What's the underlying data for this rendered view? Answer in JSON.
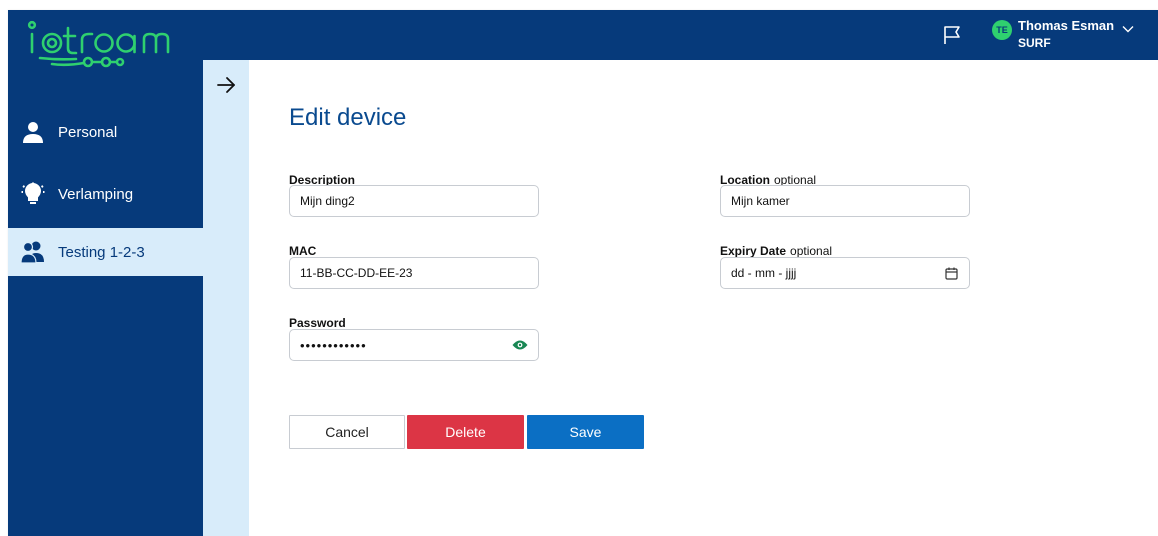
{
  "app": {
    "logo_text": "iotroam",
    "brand_colors": {
      "navy": "#063a7b",
      "green": "#2fd06f",
      "light_blue": "#d8ecfa"
    }
  },
  "header": {
    "flag_icon": "flag-icon",
    "user": {
      "initials": "TE",
      "name": "Thomas Esman",
      "org": "SURF",
      "chevron_icon": "chevron-down-icon"
    }
  },
  "sidebar": {
    "items": [
      {
        "label": "Personal",
        "icon": "person-icon",
        "active": false
      },
      {
        "label": "Verlamping",
        "icon": "lamp-icon",
        "active": false
      },
      {
        "label": "Testing 1-2-3",
        "icon": "group-icon",
        "active": true
      }
    ],
    "expand_icon": "arrow-right-icon"
  },
  "form": {
    "title": "Edit device",
    "description": {
      "label": "Description",
      "value": "Mijn ding2"
    },
    "mac": {
      "label": "MAC",
      "value": "11-BB-CC-DD-EE-23"
    },
    "password": {
      "label": "Password",
      "value": "••••••••••••",
      "toggle_icon": "eye-icon"
    },
    "location": {
      "label": "Location",
      "optional": "optional",
      "value": "Mijn kamer"
    },
    "expiry": {
      "label": "Expiry Date",
      "optional": "optional",
      "placeholder": "dd - mm - jjjj",
      "calendar_icon": "calendar-icon"
    }
  },
  "actions": {
    "cancel": "Cancel",
    "delete": "Delete",
    "save": "Save",
    "colors": {
      "delete": "#dc3545",
      "save": "#0b6fc4"
    }
  }
}
